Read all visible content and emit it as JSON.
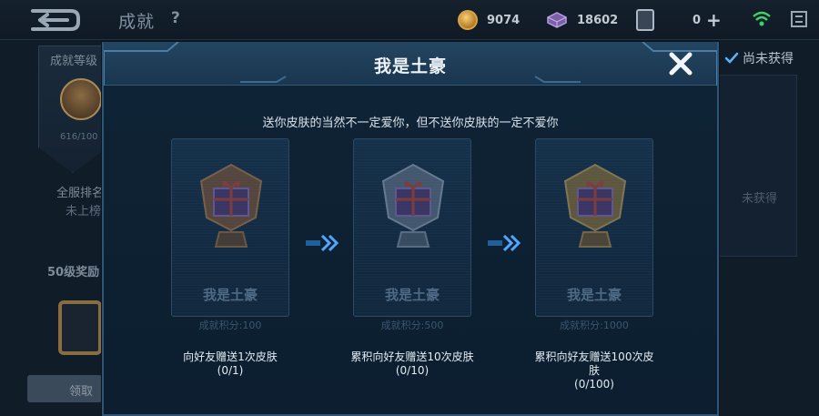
{
  "topbar": {
    "title": "成就",
    "help": "?",
    "gold": "9074",
    "diamonds": "18602",
    "vouchers": "0"
  },
  "background": {
    "left_level_label": "成就等级",
    "left_level_progress": "616/100",
    "left_rank_label": "全服排名",
    "left_rank_value": "未上榜",
    "left_reward_label": "50级奖励",
    "left_button_label": "领取",
    "right_filter_label": "尚未获得",
    "right_card_text": "未获得"
  },
  "modal": {
    "title": "我是土豪",
    "subtitle": "送你皮肤的当然不一定爱你，但不送你皮肤的一定不爱你",
    "stages": [
      {
        "name": "我是土豪",
        "points": "成就积分:100",
        "desc": "向好友赠送1次皮肤",
        "progress": "(0/1)",
        "badge_color": "#8a5a3a"
      },
      {
        "name": "我是土豪",
        "points": "成就积分:500",
        "desc": "累积向好友赠送10次皮肤",
        "progress": "(0/10)",
        "badge_color": "#6a7a90"
      },
      {
        "name": "我是土豪",
        "points": "成就积分:1000",
        "desc": "累积向好友赠送100次皮肤",
        "progress": "(0/100)",
        "badge_color": "#9a7a3a"
      }
    ]
  },
  "colors": {
    "accent_blue": "#2f5677",
    "arrow_blue": "#4fa8ff",
    "text_light": "#e3ebf2"
  }
}
